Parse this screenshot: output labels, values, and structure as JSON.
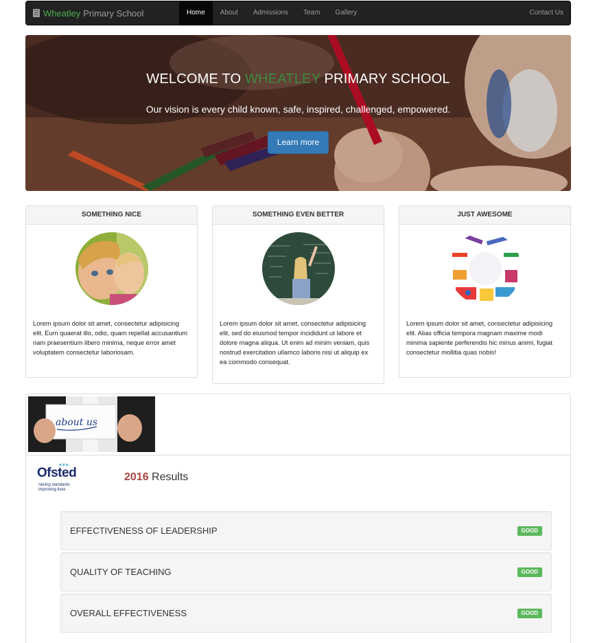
{
  "navbar": {
    "brand_green": "Wheatley",
    "brand_rest": "Primary School",
    "items": [
      {
        "label": "Home",
        "active": true
      },
      {
        "label": "About"
      },
      {
        "label": "Admissions"
      },
      {
        "label": "Team"
      },
      {
        "label": "Gallery"
      }
    ],
    "contact": "Contact Us"
  },
  "hero": {
    "title_pre": "WELCOME TO",
    "title_green": "WHEATLEY",
    "title_post": "PRIMARY SCHOOL",
    "subtitle": "Our vision is every child known, safe, inspired, challenged, empowered.",
    "button": "Learn more"
  },
  "panels": [
    {
      "title": "SOMETHING NICE",
      "text": "Lorem ipsum dolor sit amet, consectetur adipisicing elit. Eum quaerat illo, odio, quam repellat accusantium nam praesentium libero minima, neque error amet voluptatem consectetur laboriosam."
    },
    {
      "title": "SOMETHING EVEN BETTER",
      "text": "Lorem ipsum dolor sit amet, consectetur adipisicing elit, sed do eiusmod tempor incididunt ut labore et dolore magna aliqua. Ut enim ad minim veniam, quis nostrud exercitation ullamco laboris nisi ut aliquip ex ea commodo consequat."
    },
    {
      "title": "JUST AWESOME",
      "text": "Lorem ipsum dolor sit amet, consectetur adipisicing elit. Alias officia tempora magnam maxime modi minima sapiente perferendis hic minus animi, fugiat consectetur mollitia quas nobis!"
    }
  ],
  "about": {
    "card_text": "about us",
    "ofsted_word": "Ofsted",
    "ofsted_tagline": "raising standards improving lives",
    "results_year": "2016",
    "results_label": "Results",
    "results": [
      {
        "label": "EFFECTIVENESS OF LEADERSHIP",
        "badge": "GOOD"
      },
      {
        "label": "QUALITY OF TEACHING",
        "badge": "GOOD"
      },
      {
        "label": "OVERALL EFFECTIVENESS",
        "badge": "GOOD"
      }
    ]
  },
  "colors": {
    "brand_green": "#4cae4c",
    "primary_button": "#337ab7",
    "badge_good": "#5cb85c",
    "year_red": "#a94442"
  }
}
